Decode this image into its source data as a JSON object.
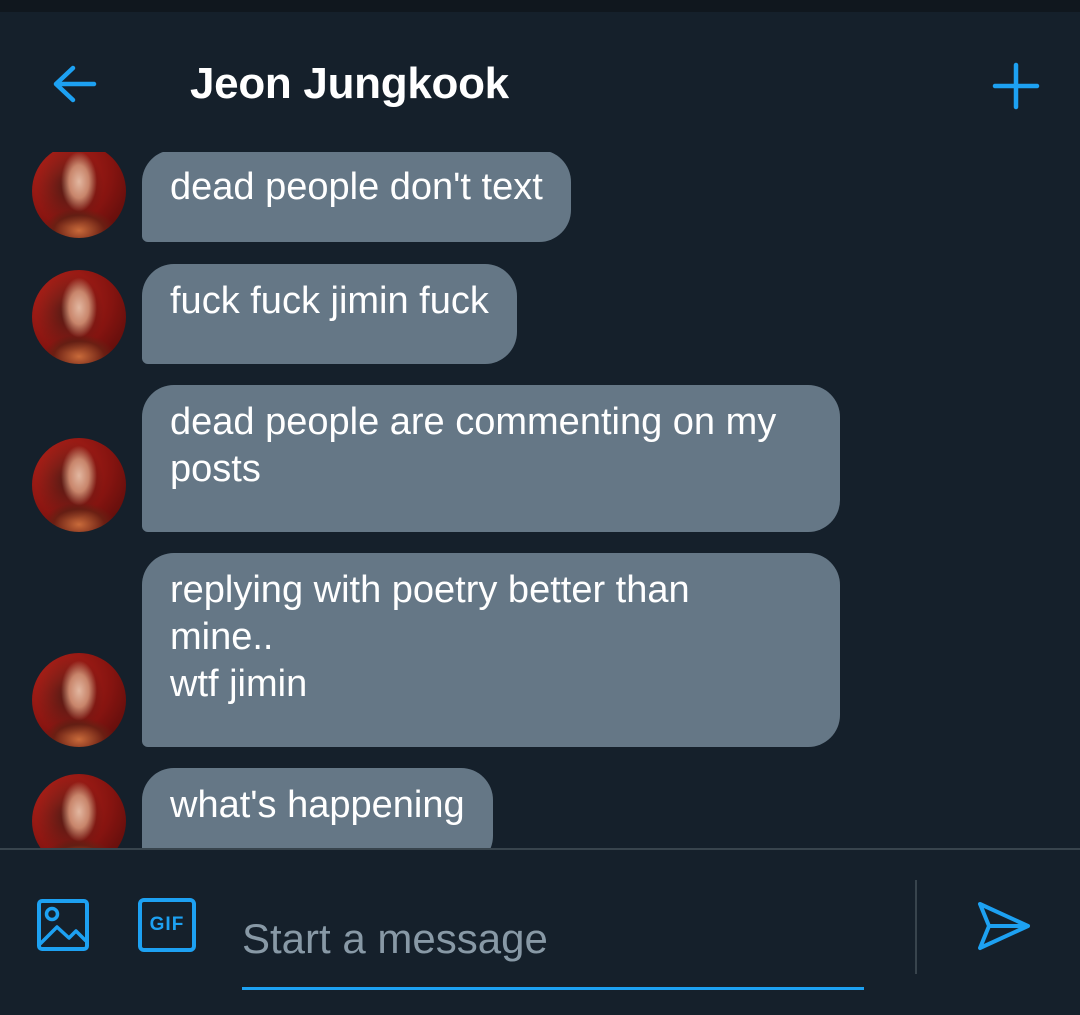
{
  "header": {
    "title": "Jeon Jungkook"
  },
  "messages": [
    {
      "text": "dead people don't text"
    },
    {
      "text": "fuck fuck jimin fuck"
    },
    {
      "text": "dead people are commenting on my\nposts"
    },
    {
      "text": "replying with poetry better than\nmine..\nwtf jimin"
    },
    {
      "text": "what's happening"
    }
  ],
  "composer": {
    "gif_label": "GIF",
    "placeholder": "Start a message"
  },
  "colors": {
    "background": "#15202b",
    "bubble": "#657786",
    "accent": "#1da1f2",
    "divider": "#38444d",
    "placeholder": "#8899a6"
  },
  "icons": {
    "back": "arrow-left-icon",
    "new": "plus-icon",
    "media": "image-icon",
    "send": "send-icon"
  }
}
